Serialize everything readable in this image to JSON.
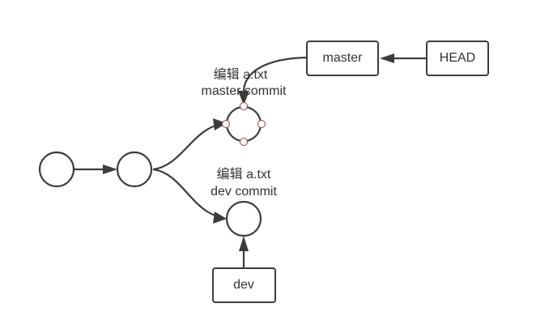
{
  "diagram": {
    "refs": {
      "master": "master",
      "head": "HEAD",
      "dev": "dev"
    },
    "commit_labels": {
      "master_commit": {
        "line1": "编辑 a.txt",
        "line2": "master commit"
      },
      "dev_commit": {
        "line1": "编辑 a.txt",
        "line2": "dev commit"
      }
    },
    "commits": [
      {
        "id": "c1",
        "selected": false
      },
      {
        "id": "c2",
        "selected": false
      },
      {
        "id": "master-commit",
        "selected": true
      },
      {
        "id": "dev-commit",
        "selected": false
      }
    ],
    "colors": {
      "stroke": "#3c3c3c",
      "text": "#333333",
      "selection_handle": "#a04040"
    }
  }
}
